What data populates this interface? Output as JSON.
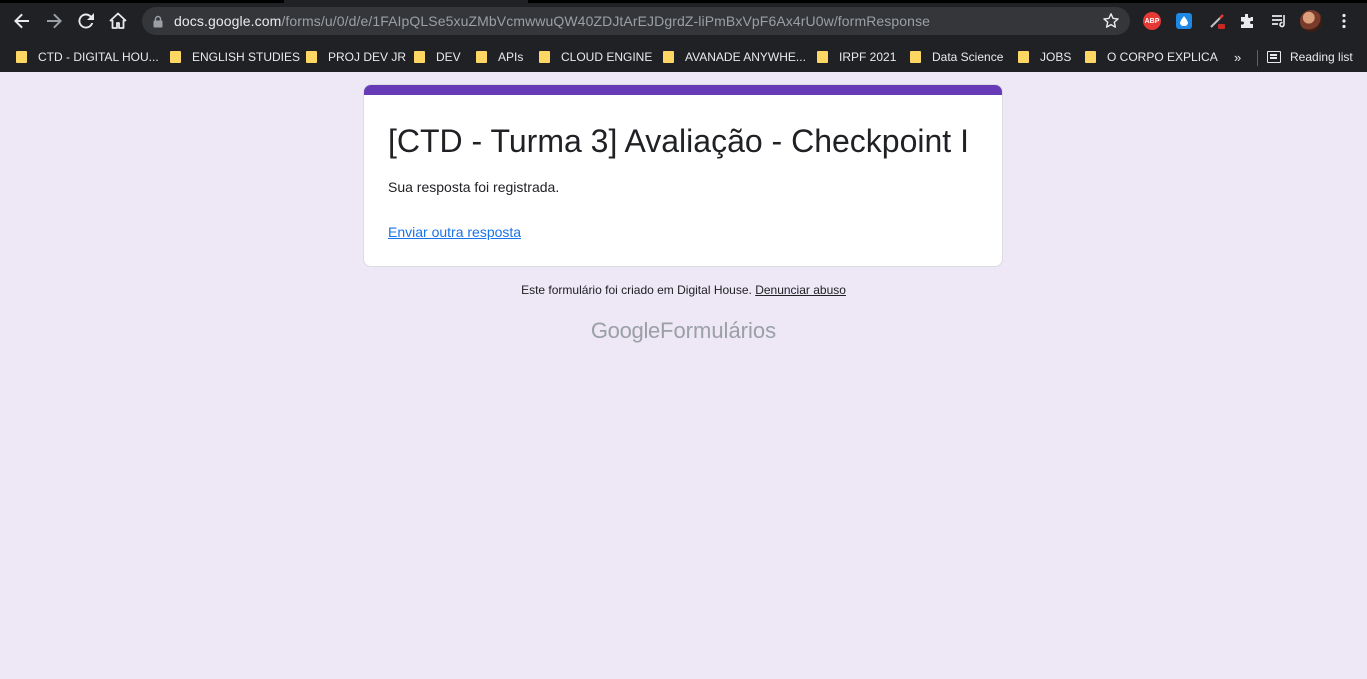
{
  "browser": {
    "url_domain": "docs.google.com",
    "url_path": "/forms/u/0/d/e/1FAIpQLSe5xuZMbVcmwwuQW40ZDJtArEJDgrdZ-liPmBxVpF6Ax4rU0w/formResponse",
    "extensions": {
      "abp_label": "ABP"
    },
    "bookmarks": [
      {
        "label": "CTD - DIGITAL HOU..."
      },
      {
        "label": "ENGLISH STUDIES"
      },
      {
        "label": "PROJ DEV JR"
      },
      {
        "label": "DEV"
      },
      {
        "label": "APIs"
      },
      {
        "label": "CLOUD ENGINE"
      },
      {
        "label": "AVANADE ANYWHE..."
      },
      {
        "label": "IRPF 2021"
      },
      {
        "label": "Data Science"
      },
      {
        "label": "JOBS"
      },
      {
        "label": "O CORPO EXPLICA"
      }
    ],
    "more_label": "»",
    "reading_list_label": "Reading list"
  },
  "form": {
    "title": "[CTD - Turma 3] Avaliação - Checkpoint I",
    "message": "Sua resposta foi registrada.",
    "send_another_label": "Enviar outra resposta"
  },
  "footer": {
    "created_in": "Este formulário foi criado em Digital House.",
    "report_abuse": "Denunciar abuso",
    "brand_google": "Google",
    "brand_product": "Formulários"
  },
  "colors": {
    "accent": "#673ab7",
    "page_background": "#ede7f6",
    "link": "#1a73e8"
  }
}
